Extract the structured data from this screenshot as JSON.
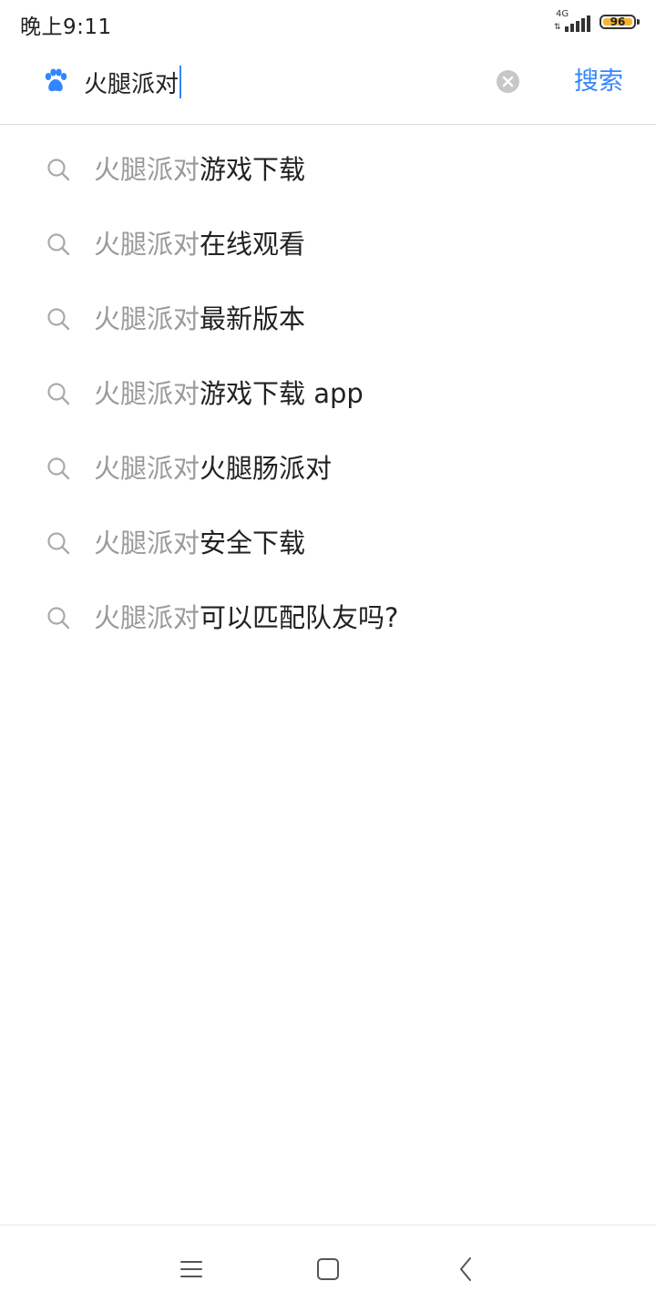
{
  "status_bar": {
    "time": "晚上9:11",
    "network_type": "4G",
    "battery_level": "96",
    "battery_color": "#f5b533"
  },
  "search": {
    "logo_icon": "baidu-paw-icon",
    "query": "火腿派对",
    "clear_icon": "clear-circle-icon",
    "button_label": "搜索",
    "accent_color": "#3385ff"
  },
  "suggestions": [
    {
      "prefix": "火腿派对",
      "suffix": "游戏下载"
    },
    {
      "prefix": "火腿派对",
      "suffix": "在线观看"
    },
    {
      "prefix": "火腿派对",
      "suffix": "最新版本"
    },
    {
      "prefix": "火腿派对",
      "suffix": "游戏下载 app"
    },
    {
      "prefix": "火腿派对",
      "suffix": "火腿肠派对"
    },
    {
      "prefix": "火腿派对",
      "suffix": "安全下载"
    },
    {
      "prefix": "火腿派对",
      "suffix": "可以匹配队友吗?"
    }
  ],
  "nav_bar": {
    "menu_icon": "menu-icon",
    "home_icon": "home-icon",
    "back_icon": "back-icon"
  }
}
